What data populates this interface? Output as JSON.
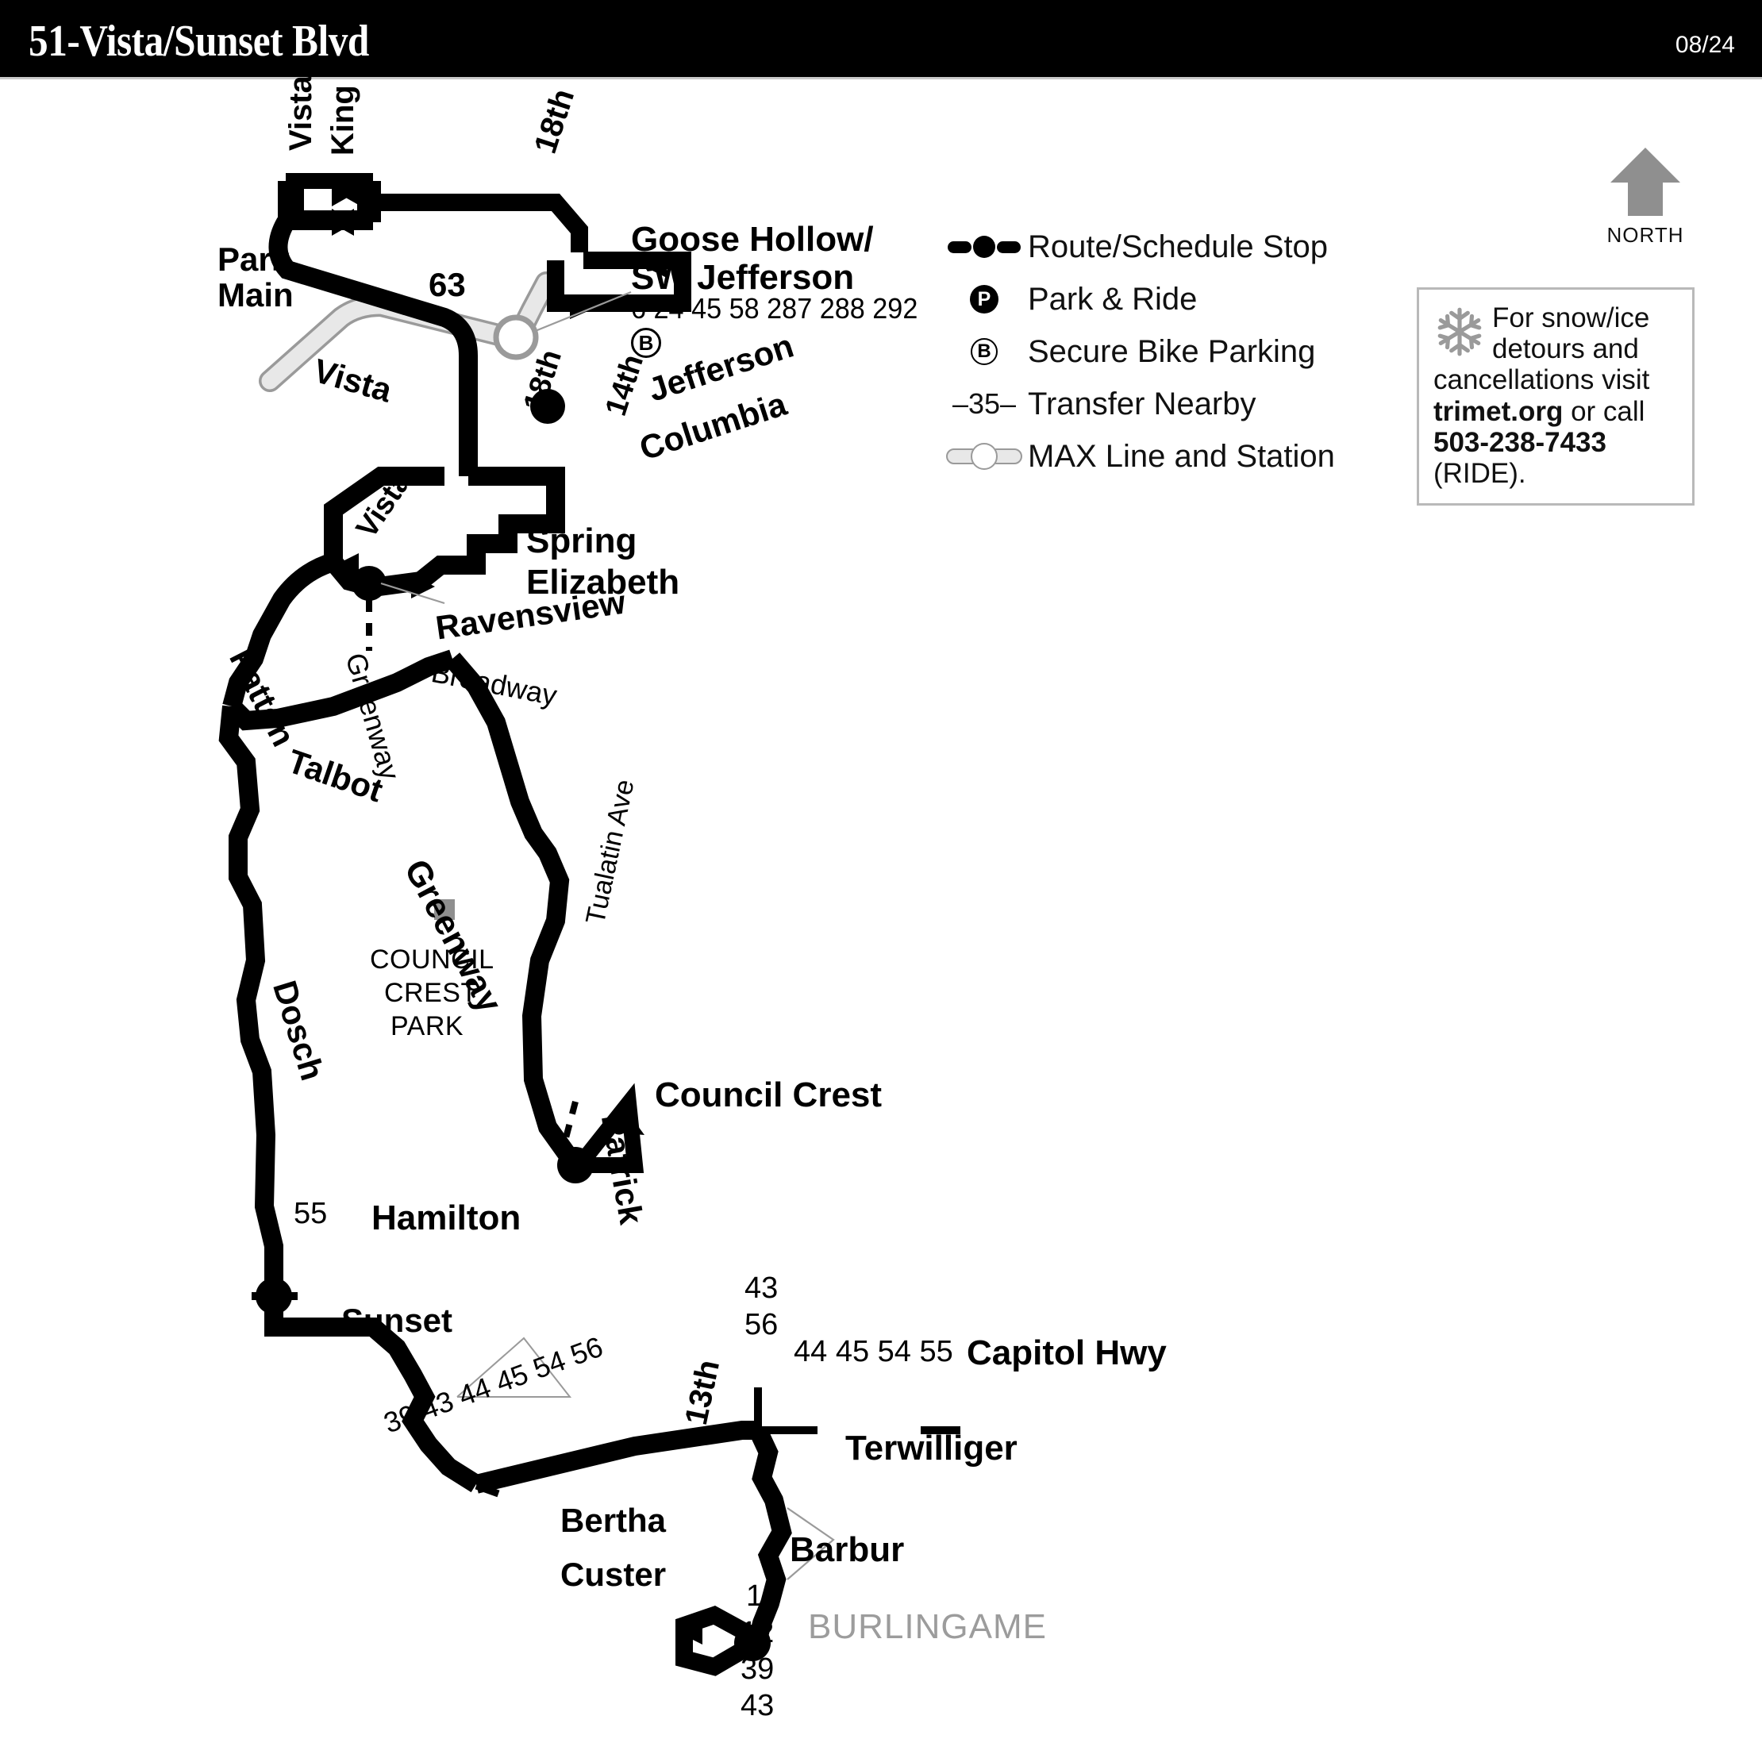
{
  "header": {
    "route_title": "51-Vista/Sunset Blvd",
    "date": "08/24"
  },
  "legend": {
    "items": [
      {
        "symbol": "route-stop-icon",
        "label": "Route/Schedule Stop"
      },
      {
        "symbol": "park-and-ride-icon",
        "glyph": "P",
        "label": "Park & Ride"
      },
      {
        "symbol": "secure-bike-parking-icon",
        "glyph": "B",
        "label": "Secure Bike Parking"
      },
      {
        "symbol": "transfer-nearby-icon",
        "glyph": "–35–",
        "label": "Transfer Nearby"
      },
      {
        "symbol": "max-line-station-icon",
        "label": "MAX Line and Station"
      }
    ]
  },
  "compass": {
    "label": "NORTH"
  },
  "notice": {
    "line1": "For snow/ice",
    "line2": "detours and",
    "line3": "cancellations visit",
    "link": "trimet.org",
    "mid": " or call ",
    "phone": "503-238-7433",
    "suffix": " (RIDE)."
  },
  "map": {
    "street_labels": [
      {
        "name": "park",
        "text": "Park"
      },
      {
        "name": "main",
        "text": "Main"
      },
      {
        "name": "vista-top",
        "text": "Vista"
      },
      {
        "name": "king",
        "text": "King"
      },
      {
        "name": "18th-top",
        "text": "18th"
      },
      {
        "name": "route-63",
        "text": "63"
      },
      {
        "name": "vista-upper",
        "text": "Vista"
      },
      {
        "name": "jefferson",
        "text": "Jefferson"
      },
      {
        "name": "columbia",
        "text": "Columbia"
      },
      {
        "name": "14th",
        "text": "14th"
      },
      {
        "name": "18th-mid",
        "text": "18th"
      },
      {
        "name": "vista-mid",
        "text": "Vista"
      },
      {
        "name": "spring",
        "text": "Spring"
      },
      {
        "name": "elizabeth",
        "text": "Elizabeth"
      },
      {
        "name": "ravensview",
        "text": "Ravensview"
      },
      {
        "name": "broadway",
        "text": "Broadway"
      },
      {
        "name": "patton",
        "text": "Patton"
      },
      {
        "name": "greenway-upper",
        "text": "Greenway"
      },
      {
        "name": "talbot",
        "text": "Talbot"
      },
      {
        "name": "greenway-lower",
        "text": "Greenway"
      },
      {
        "name": "dosch",
        "text": "Dosch"
      },
      {
        "name": "tualatin-ave",
        "text": "Tualatin Ave"
      },
      {
        "name": "patrick",
        "text": "Patrick"
      },
      {
        "name": "council-crest",
        "text": "Council Crest"
      },
      {
        "name": "hamilton",
        "text": "Hamilton"
      },
      {
        "name": "sunset",
        "text": "Sunset"
      },
      {
        "name": "capitol-hwy",
        "text": "Capitol Hwy"
      },
      {
        "name": "terwilliger",
        "text": "Terwilliger"
      },
      {
        "name": "13th",
        "text": "13th"
      },
      {
        "name": "bertha",
        "text": "Bertha"
      },
      {
        "name": "custer",
        "text": "Custer"
      },
      {
        "name": "barbur",
        "text": "Barbur"
      }
    ],
    "station": {
      "name": "Goose Hollow/\nSW Jefferson",
      "line1": "Goose Hollow/",
      "line2": "SW Jefferson",
      "transfers": "6 24 45 58 287 288 292",
      "bike_badge": "B"
    },
    "park_label": {
      "line1": "COUNCIL",
      "line2": "CREST",
      "line3": "PARK"
    },
    "neighborhood": "BURLINGAME",
    "transfers": {
      "hamilton": "55",
      "capitol_hwy_vertical": [
        "43",
        "56"
      ],
      "capitol_hwy_horizontal": "44 45 54 55",
      "sunset_diagonal": "39 43 44 45 54 56",
      "barbur_vertical": [
        "1",
        "12",
        "39",
        "43"
      ]
    }
  },
  "colors": {
    "header_bg": "#000000",
    "route": "#000000",
    "max_line": "#e8e8e8",
    "max_line_border": "#9a9a9a",
    "park_marker": "#8f8f8f",
    "neighborhood_text": "#9c9c9c",
    "notice_border": "#b9b9b9"
  }
}
